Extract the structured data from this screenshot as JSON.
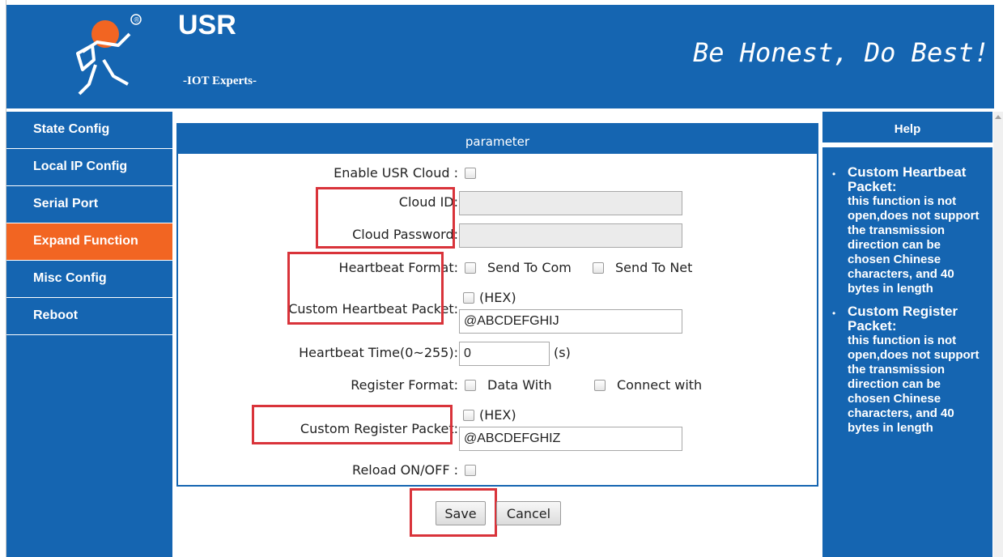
{
  "header": {
    "brand": "USR",
    "sub": "-IOT Experts-",
    "slogan": "Be Honest, Do Best!",
    "registered": "®"
  },
  "sidebar": {
    "items": [
      {
        "label": "State Config",
        "active": false
      },
      {
        "label": "Local IP Config",
        "active": false
      },
      {
        "label": "Serial Port",
        "active": false
      },
      {
        "label": "Expand Function",
        "active": true
      },
      {
        "label": "Misc Config",
        "active": false
      },
      {
        "label": "Reboot",
        "active": false
      }
    ]
  },
  "panel": {
    "title": "parameter",
    "enable_cloud_label": "Enable USR Cloud :",
    "enable_cloud_checked": false,
    "cloud_id_label": "Cloud ID:",
    "cloud_id_value": "",
    "cloud_password_label": "Cloud Password:",
    "cloud_password_value": "",
    "heartbeat_format_label": "Heartbeat Format:",
    "send_to_com": "Send To Com",
    "send_to_net": "Send To Net",
    "hex_label": "(HEX)",
    "custom_heartbeat_label": "Custom Heartbeat Packet:",
    "custom_heartbeat_value": "@ABCDEFGHIJ",
    "heartbeat_time_label": "Heartbeat Time(0~255):",
    "heartbeat_time_value": "0",
    "heartbeat_time_unit": "(s)",
    "register_format_label": "Register Format:",
    "data_with": "Data With",
    "connect_with": "Connect with",
    "custom_register_label": "Custom Register Packet:",
    "custom_register_value": "@ABCDEFGHIZ",
    "reload_label": "Reload ON/OFF :",
    "save": "Save",
    "cancel": "Cancel"
  },
  "help": {
    "title": "Help",
    "items": [
      {
        "title": "Custom Heartbeat Packet:",
        "text": "this function is not open,does not support the transmission direction can be chosen Chinese characters, and 40 bytes in length"
      },
      {
        "title": "Custom Register Packet:",
        "text": "this function is not open,does not support the transmission direction can be chosen Chinese characters, and 40 bytes in length"
      }
    ]
  },
  "colors": {
    "brand_blue": "#1565b1",
    "active_orange": "#f26522",
    "highlight_red": "#d9333a"
  }
}
